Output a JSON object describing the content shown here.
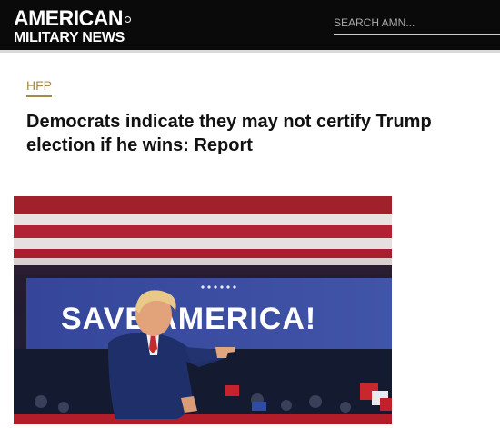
{
  "header": {
    "logo_line1": "AMERICAN",
    "logo_line2": "MILITARY NEWS",
    "search_placeholder": "SEARCH AMN..."
  },
  "article": {
    "category": "HFP",
    "title": "Democrats indicate they may not certify Trump election if he wins: Report"
  },
  "hero_image": {
    "banner_text": "SAVE AMERICA!",
    "colors": {
      "banner_blue": "#3a4a9a",
      "stripe_red": "#b22234",
      "suit_navy": "#1f2f6a"
    }
  }
}
